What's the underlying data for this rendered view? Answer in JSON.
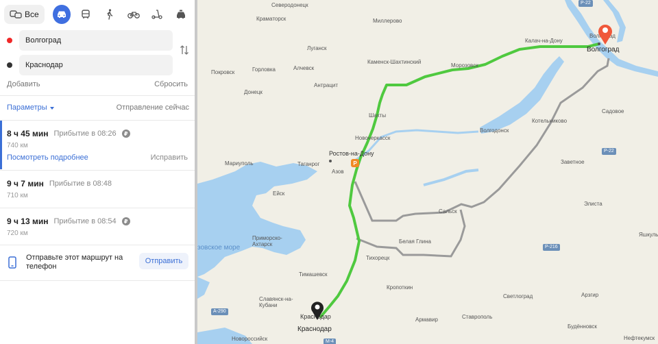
{
  "modes": {
    "all_label": "Все",
    "items": [
      {
        "name": "car-icon",
        "active": true
      },
      {
        "name": "bus-icon",
        "active": false
      },
      {
        "name": "walk-icon",
        "active": false
      },
      {
        "name": "bicycle-icon",
        "active": false
      },
      {
        "name": "scooter-icon",
        "active": false
      },
      {
        "name": "taxi-icon",
        "active": false
      }
    ]
  },
  "points": {
    "from": {
      "value": "Волгоград",
      "dot_color": "#f02828"
    },
    "to": {
      "value": "Краснодар",
      "dot_color": "#333333"
    }
  },
  "actions": {
    "add_label": "Добавить",
    "reset_label": "Сбросить"
  },
  "options": {
    "params_label": "Параметры",
    "departure_label": "Отправление сейчас"
  },
  "routes": [
    {
      "time": "8 ч 45 мин",
      "arrival": "Прибытие в 08:26",
      "distance": "740 км",
      "toll": true,
      "toll_icon": "₽",
      "details_label": "Посмотреть подробнее",
      "fix_label": "Исправить",
      "selected": true
    },
    {
      "time": "9 ч 7 мин",
      "arrival": "Прибытие в 08:48",
      "distance": "710 км",
      "toll": false,
      "selected": false
    },
    {
      "time": "9 ч 13 мин",
      "arrival": "Прибытие в 08:54",
      "distance": "720 км",
      "toll": true,
      "toll_icon": "₽",
      "selected": false
    }
  ],
  "send": {
    "text": "Отправьте этот маршрут на телефон",
    "button_label": "Отправить"
  },
  "colors": {
    "accent": "#3b6fd6",
    "route_main": "#4fc93f",
    "route_alt": "#9a9a9a",
    "water": "#a7d0f0",
    "land": "#f1efe6"
  },
  "map": {
    "cities": {
      "volgograd": "Волгоград",
      "krasnodar": "Краснодар",
      "rostov": "Ростов-на-Дону",
      "shakhty": "Шахты",
      "novocherkassk": "Новочеркасск",
      "taganrog": "Таганрог",
      "azov": "Азов",
      "mariupol": "Мариуполь",
      "donetsk": "Донецк",
      "lugansk": "Луганск",
      "kramatorsk": "Краматорск",
      "severodonetsk": "Северодонецк",
      "millerovo": "Миллерово",
      "kamensk": "Каменск-Шахтинский",
      "gorlovka": "Горловка",
      "alchevsk": "Алчевск",
      "antratsit": "Антрацит",
      "pokrovsk": "Покровск",
      "morozovsk": "Морозовск",
      "kalach": "Калач-на-Дону",
      "volgodonsk": "Волгодонск",
      "kotelnikovo": "Котельниково",
      "sadovoe": "Садовое",
      "zavetnoe": "Заветное",
      "salsk": "Сальск",
      "elista": "Элиста",
      "yashkul": "Яшкуль",
      "belaya_glina": "Белая Глина",
      "tikhoretsk": "Тихорецк",
      "primorsko": "Приморско-Ахтарск",
      "timashevsk": "Тимашевск",
      "slavyansk": "Славянск-на-Кубани",
      "kropotkin": "Кропоткин",
      "armavir": "Армавир",
      "stavropol": "Ставрополь",
      "svetlograd": "Светлоград",
      "arzgir": "Арзгир",
      "budennovsk": "Будённовск",
      "neftekumsk": "Нефтекумск",
      "novorossiysk": "Новороссийск",
      "eysk": "Ейск",
      "sea": "зовское море"
    },
    "roads": {
      "r22a": "Р-22",
      "r22b": "Р-22",
      "r216": "Р-216",
      "a290": "А-290",
      "m4": "М-4"
    },
    "poi": {
      "fuel_icon": "Р"
    }
  }
}
